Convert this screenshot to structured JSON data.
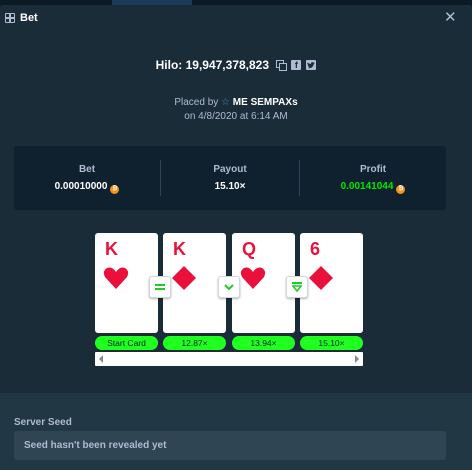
{
  "modal": {
    "title": "Bet",
    "game_id": "Hilo: 19,947,378,823",
    "placed_by_prefix": "Placed by",
    "user": "ME SEMPAXs",
    "placed_on": "on 4/8/2020 at 6:14 AM"
  },
  "stats": {
    "bet_label": "Bet",
    "bet_value": "0.00010000",
    "payout_label": "Payout",
    "payout_value": "15.10×",
    "profit_label": "Profit",
    "profit_value": "0.00141044",
    "currency_symbol": "₿"
  },
  "cards": [
    {
      "rank": "K",
      "suit": "heart",
      "label": "Start Card"
    },
    {
      "rank": "K",
      "suit": "diamond",
      "label": "12.87×"
    },
    {
      "rank": "Q",
      "suit": "heart",
      "label": "13.94×"
    },
    {
      "rank": "6",
      "suit": "diamond",
      "label": "15.10×"
    }
  ],
  "guesses": [
    "equal",
    "lower",
    "lower-or-equal"
  ],
  "seed": {
    "label": "Server Seed",
    "placeholder": "Seed hasn't been revealed yet"
  },
  "colors": {
    "card_red": "#e9113c",
    "profit_green": "#00e701",
    "label_green": "#1fff20"
  }
}
